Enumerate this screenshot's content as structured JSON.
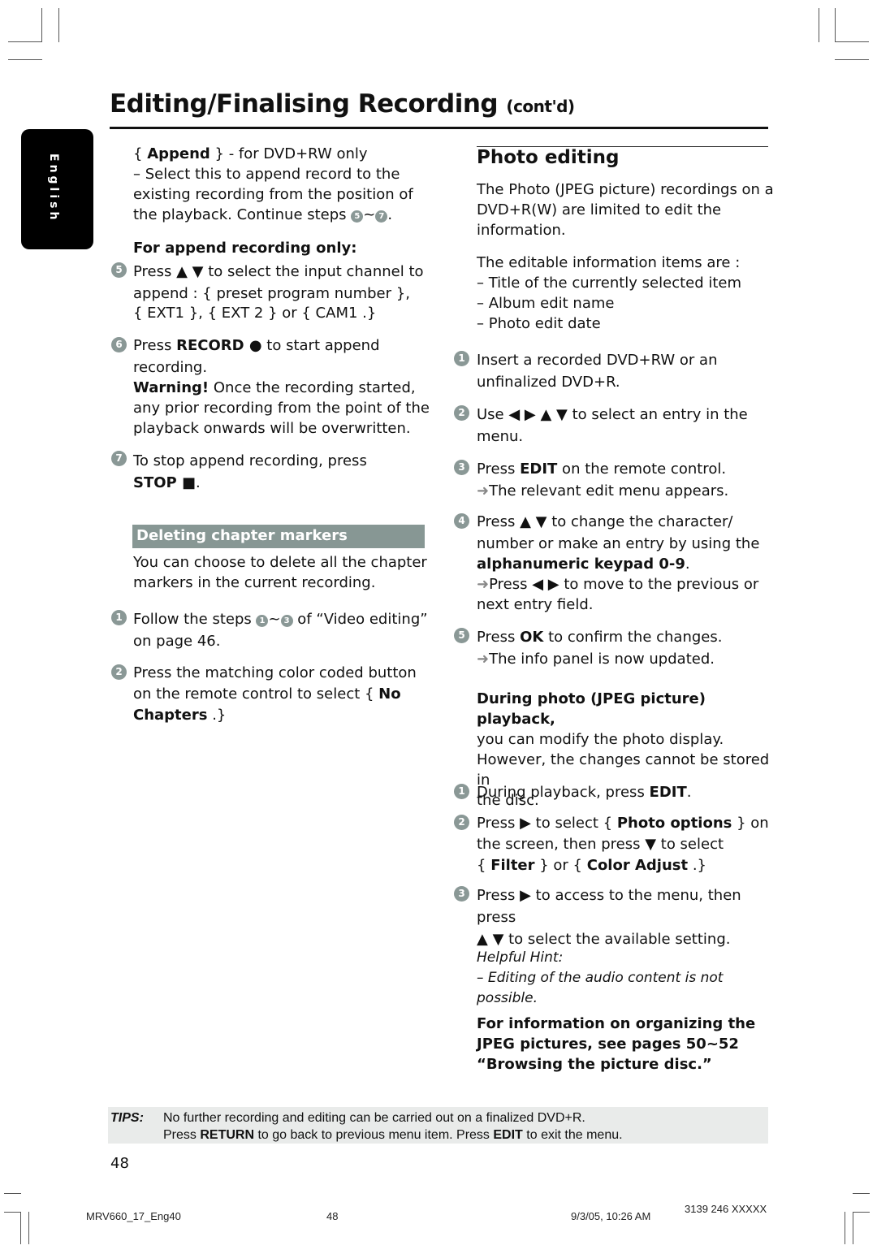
{
  "header": {
    "title": "Editing/Finalising Recording",
    "title_suffix": "(cont'd)"
  },
  "language_tab": "English",
  "left": {
    "append": {
      "label": "Append",
      "label_prefix": "{ ",
      "label_suffix": " } - for DVD+RW only",
      "desc_line1": "–  Select this to append record to the",
      "desc_line2": "existing recording from the position of",
      "desc_line3": "the playback.  Continue steps ",
      "step_from": "5",
      "step_to": "7"
    },
    "append_heading": "For append recording only:",
    "steps": [
      {
        "num": "5",
        "text1": "Press ▲ ▼ to select the input channel to",
        "text2": "append : { preset program number },",
        "text3": "{ EXT1 }, { EXT 2 } or { CAM1 .}"
      },
      {
        "num": "6",
        "pre": "Press ",
        "bold": "RECORD ●",
        "post": " to start append",
        "text2": "recording.",
        "warn_bold": "Warning!",
        "warn_text": "  Once the recording started,",
        "warn2": "any prior recording from the point of the",
        "warn3": "playback onwards will be overwritten."
      },
      {
        "num": "7",
        "text1": "To stop append recording, press",
        "bold": "STOP ■",
        "post": "."
      }
    ],
    "chapter_section": {
      "heading": "Deleting chapter markers",
      "intro1": "You can choose to delete all the chapter",
      "intro2": "markers in the current recording.",
      "steps": [
        {
          "num": "1",
          "pre": "Follow the steps ",
          "from": "1",
          "to": "3",
          "post": " of “Video editing”",
          "text2": "on page 46."
        },
        {
          "num": "2",
          "text1": "Press the matching color coded button",
          "pre2": "on the remote control to select { ",
          "bold2": "No",
          "bold3": "Chapters",
          "post3": " .}"
        }
      ]
    }
  },
  "right": {
    "heading": "Photo editing",
    "intro1": "The Photo (JPEG picture) recordings on a",
    "intro2": "DVD+R(W) are limited to edit the",
    "intro3": "information.",
    "items_intro": "The editable information items are :",
    "items": [
      "–  Title of the currently selected item",
      "–  Album edit name",
      "–  Photo edit date"
    ],
    "steps": [
      {
        "num": "1",
        "text1": "Insert a recorded DVD+RW or an",
        "text2": "unfinalized DVD+R."
      },
      {
        "num": "2",
        "text1": "Use ◀ ▶ ▲ ▼ to select an entry in the",
        "text2": "menu."
      },
      {
        "num": "3",
        "pre": "Press ",
        "bold": "EDIT",
        "post": " on the remote control.",
        "result": "The relevant edit menu appears."
      },
      {
        "num": "4",
        "text1": "Press ▲ ▼ to change the character/",
        "text2": "number or make an entry by using the",
        "bold": "alphanumeric keypad 0-9",
        "post": ".",
        "result": "Press ◀ ▶ to move to the previous or",
        "result2": "next entry field."
      },
      {
        "num": "5",
        "pre": "Press ",
        "bold": "OK",
        "post": " to confirm the changes.",
        "result": "The info panel is now updated."
      }
    ],
    "playback": {
      "heading": "During photo (JPEG picture) playback,",
      "line2": "you can modify the photo display.",
      "line3": "However, the changes cannot be stored in",
      "line4": "the disc.",
      "steps": [
        {
          "num": "1",
          "pre": "During playback, press ",
          "bold": "EDIT",
          "post": "."
        },
        {
          "num": "2",
          "pre": "Press ▶ to select { ",
          "bold": "Photo options",
          "post": " } on",
          "text2": "the screen, then press ▼ to select",
          "p3a": "{ ",
          "b3a": "Filter",
          "p3b": " } or { ",
          "b3b": "Color Adjust",
          "p3c": " .}"
        },
        {
          "num": "3",
          "text1": "Press ▶ to access to the menu, then press",
          "text2": "▲ ▼ to select the available setting."
        }
      ]
    },
    "hint_title": "Helpful Hint:",
    "hint_text": "–  Editing of the audio content is not possible.",
    "info1": "For information on organizing the",
    "info2": "JPEG pictures, see pages 50~52",
    "info3": "“Browsing the picture disc.”"
  },
  "tips": {
    "label": "TIPS:",
    "line1": "No further recording and editing can be carried out on a finalized DVD+R.",
    "line2_pre": "Press ",
    "line2_b1": "RETURN",
    "line2_mid": " to go back to previous menu item.  Press ",
    "line2_b2": "EDIT",
    "line2_post": " to exit the menu."
  },
  "page_number": "48",
  "footer": {
    "file": "MRV660_17_Eng40",
    "page": "48",
    "datetime": "9/3/05, 10:26 AM",
    "code": "3139 246 XXXXX"
  }
}
